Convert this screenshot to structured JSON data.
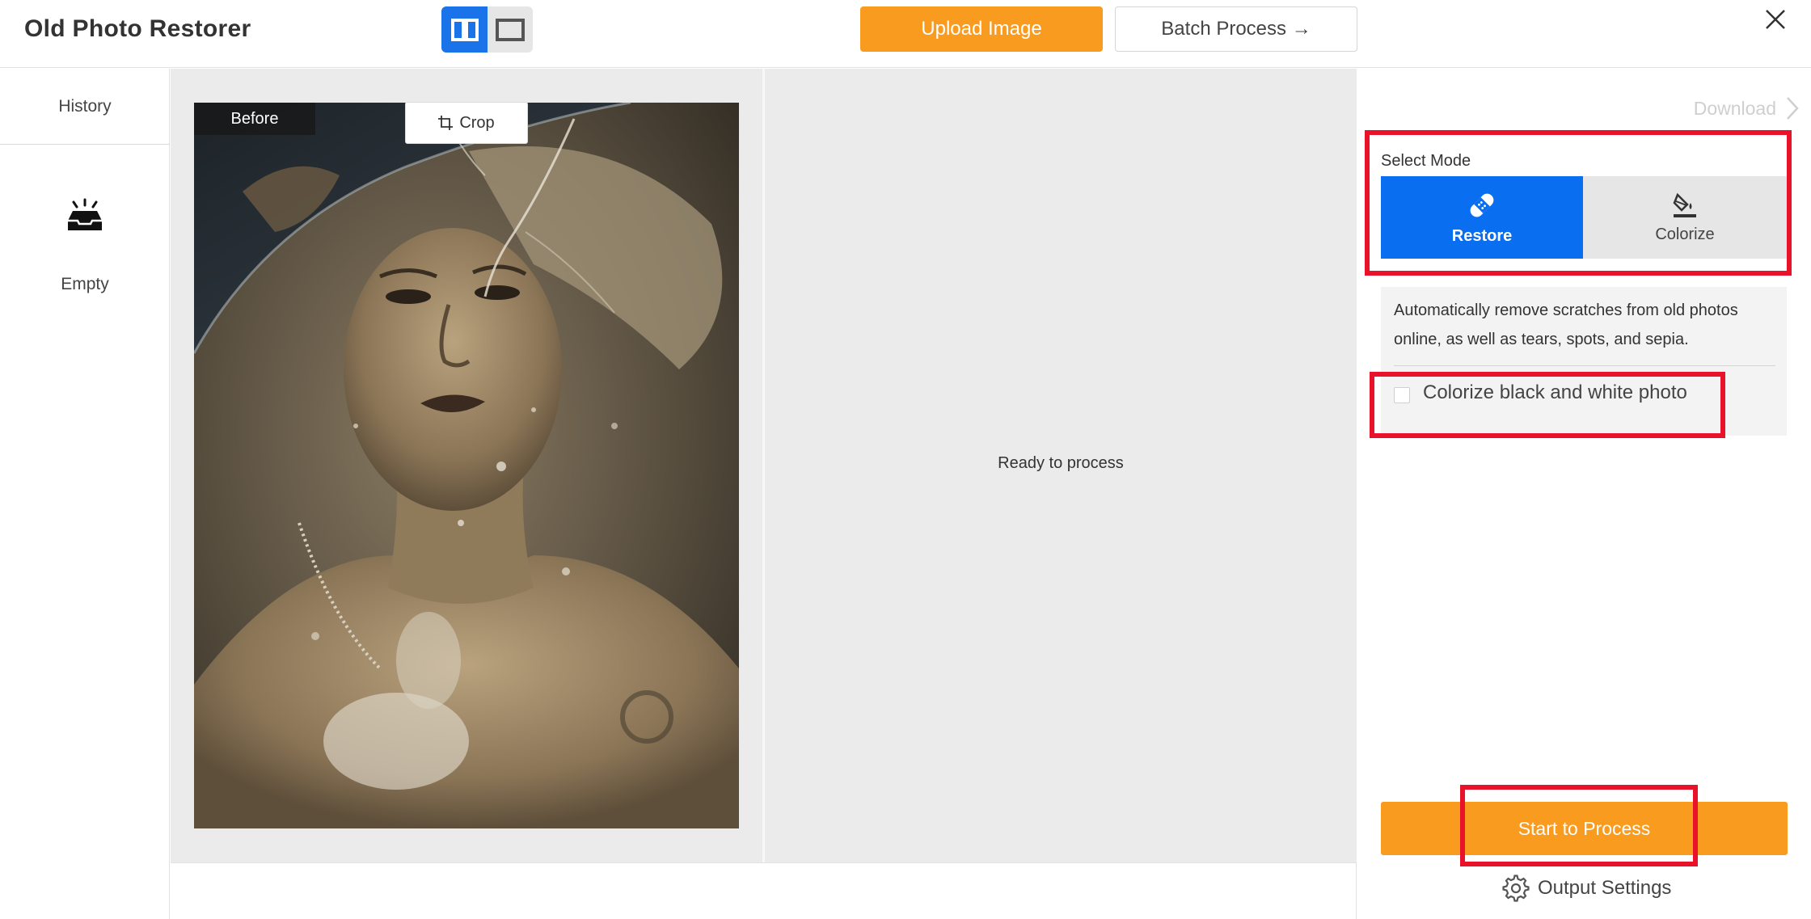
{
  "header": {
    "title": "Old Photo Restorer",
    "upload_label": "Upload Image",
    "batch_label": "Batch Process →"
  },
  "sidebar": {
    "history_label": "History",
    "empty_label": "Empty"
  },
  "canvas": {
    "before_label": "Before",
    "crop_label": "Crop",
    "ready_text": "Ready to process"
  },
  "panel": {
    "download_label": "Download",
    "select_mode_label": "Select Mode",
    "modes": [
      {
        "label": "Restore",
        "icon": "bandage-icon",
        "selected": true
      },
      {
        "label": "Colorize",
        "icon": "paint-bucket-icon",
        "selected": false
      }
    ],
    "description": "Automatically remove scratches from old photos online, as well as tears, spots, and sepia.",
    "colorize_option_label": "Colorize black and white photo",
    "colorize_checked": false,
    "start_label": "Start to Process",
    "output_settings_label": "Output Settings"
  },
  "colors": {
    "accent_orange": "#f89b1f",
    "accent_blue": "#0a6ef0",
    "highlight_red": "#e8122b"
  }
}
